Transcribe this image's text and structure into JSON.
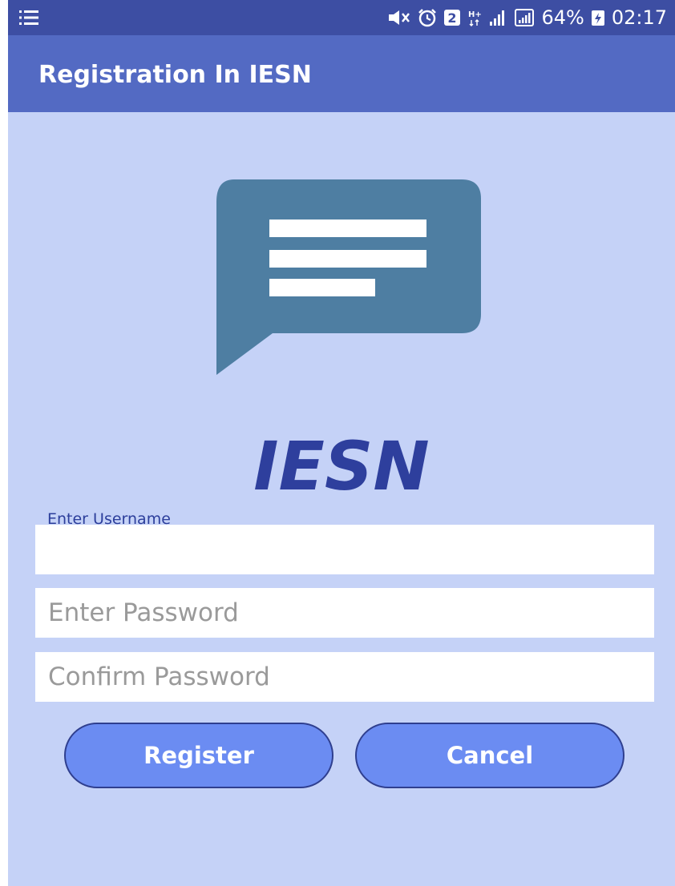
{
  "status_bar": {
    "battery_percent": "64%",
    "time": "02:17",
    "sim_badge": "2",
    "network_type": "H+",
    "icons": [
      "menu-icon",
      "mute-icon",
      "alarm-icon",
      "sim-2-icon",
      "h-plus-network-icon",
      "signal-icon",
      "signal-box-icon",
      "battery-charging-icon"
    ]
  },
  "app_bar": {
    "title": "Registration In IESN"
  },
  "logo": {
    "icon": "chat-bubble-icon",
    "color": "#4e7ea2"
  },
  "brand": {
    "name": "IESN",
    "color": "#2e3f9d"
  },
  "form": {
    "username": {
      "label": "Enter Username",
      "value": ""
    },
    "password": {
      "placeholder": "Enter Password",
      "value": ""
    },
    "confirm_password": {
      "placeholder": "Confirm Password",
      "value": ""
    }
  },
  "buttons": {
    "register_label": "Register",
    "cancel_label": "Cancel",
    "color": "#6b8cf2"
  },
  "colors": {
    "background": "#c5d2f7",
    "status_bar": "#3d4ea3",
    "app_bar": "#536ac3"
  }
}
